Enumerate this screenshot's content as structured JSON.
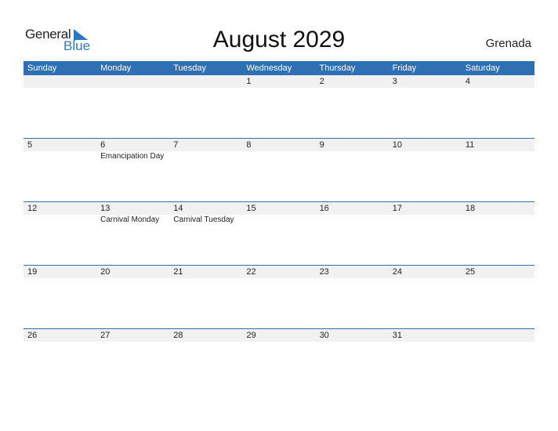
{
  "logo": {
    "word1": "General",
    "word2": "Blue"
  },
  "title": "August 2029",
  "country": "Grenada",
  "colors": {
    "header": "#2f6fb3",
    "logo_blue": "#2a77c2",
    "date_strip": "#f1f1f1"
  },
  "weekdays": [
    "Sunday",
    "Monday",
    "Tuesday",
    "Wednesday",
    "Thursday",
    "Friday",
    "Saturday"
  ],
  "weeks": [
    [
      {
        "d": ""
      },
      {
        "d": ""
      },
      {
        "d": ""
      },
      {
        "d": "1"
      },
      {
        "d": "2"
      },
      {
        "d": "3"
      },
      {
        "d": "4"
      }
    ],
    [
      {
        "d": "5"
      },
      {
        "d": "6",
        "e": "Emancipation Day"
      },
      {
        "d": "7"
      },
      {
        "d": "8"
      },
      {
        "d": "9"
      },
      {
        "d": "10"
      },
      {
        "d": "11"
      }
    ],
    [
      {
        "d": "12"
      },
      {
        "d": "13",
        "e": "Carnival Monday"
      },
      {
        "d": "14",
        "e": "Carnival Tuesday"
      },
      {
        "d": "15"
      },
      {
        "d": "16"
      },
      {
        "d": "17"
      },
      {
        "d": "18"
      }
    ],
    [
      {
        "d": "19"
      },
      {
        "d": "20"
      },
      {
        "d": "21"
      },
      {
        "d": "22"
      },
      {
        "d": "23"
      },
      {
        "d": "24"
      },
      {
        "d": "25"
      }
    ],
    [
      {
        "d": "26"
      },
      {
        "d": "27"
      },
      {
        "d": "28"
      },
      {
        "d": "29"
      },
      {
        "d": "30"
      },
      {
        "d": "31"
      },
      {
        "d": ""
      }
    ]
  ]
}
